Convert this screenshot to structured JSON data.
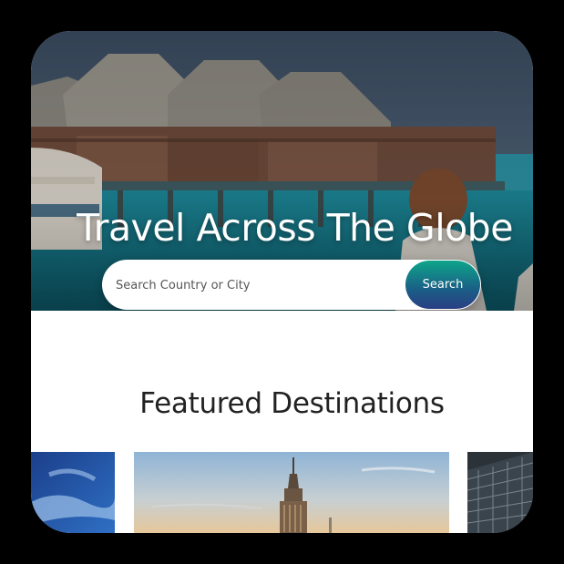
{
  "hero": {
    "title": "Travel Across The Globe",
    "background_image": "overwater-bungalows-image",
    "search": {
      "placeholder": "Search Country or City",
      "value": "",
      "button_label": "Search"
    }
  },
  "featured": {
    "title": "Featured Destinations",
    "cards": [
      {
        "image": "blue-sky-clouds-image"
      },
      {
        "image": "empire-state-building-image"
      },
      {
        "image": "glass-building-image"
      }
    ]
  },
  "colors": {
    "search_button_top": "#0ea58a",
    "search_button_bottom": "#2a3f84",
    "heading_text": "#222222",
    "page_background": "#000000"
  }
}
